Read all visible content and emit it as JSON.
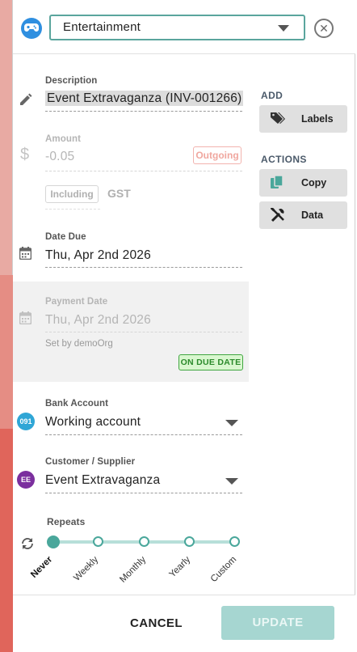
{
  "header": {
    "category": "Entertainment"
  },
  "description": {
    "label": "Description",
    "value": "Event Extravaganza (INV-001266)"
  },
  "amount": {
    "label": "Amount",
    "value": "-0.05",
    "direction": "Outgoing",
    "tax_mode": "Including",
    "tax_name": "GST"
  },
  "date_due": {
    "label": "Date Due",
    "value": "Thu, Apr 2nd 2026"
  },
  "payment_date": {
    "label": "Payment Date",
    "value": "Thu, Apr 2nd 2026",
    "set_by": "Set by demoOrg",
    "badge": "ON DUE DATE"
  },
  "bank_account": {
    "label": "Bank Account",
    "badge": "091",
    "badge_color": "#2fa6d6",
    "value": "Working account"
  },
  "contact": {
    "label": "Customer / Supplier",
    "badge": "EE",
    "badge_color": "#7b2f9e",
    "value": "Event Extravaganza"
  },
  "repeats": {
    "label": "Repeats",
    "options": [
      "Never",
      "Weekly",
      "Monthly",
      "Yearly",
      "Custom"
    ],
    "selected": "Never"
  },
  "side": {
    "add_title": "ADD",
    "labels_button": "Labels",
    "actions_title": "ACTIONS",
    "copy_button": "Copy",
    "data_button": "Data"
  },
  "footer": {
    "cancel": "CANCEL",
    "update": "UPDATE"
  },
  "colors": {
    "accent": "#4aa79b",
    "update_disabled": "#a6d6d1",
    "category_icon": "#2f8fe0"
  },
  "icons": [
    "gamepad-icon",
    "chevron-down-icon",
    "close-icon",
    "pencil-icon",
    "dollar-icon",
    "calendar-icon",
    "repeat-icon",
    "tag-icon",
    "copy-icon",
    "tools-icon"
  ]
}
